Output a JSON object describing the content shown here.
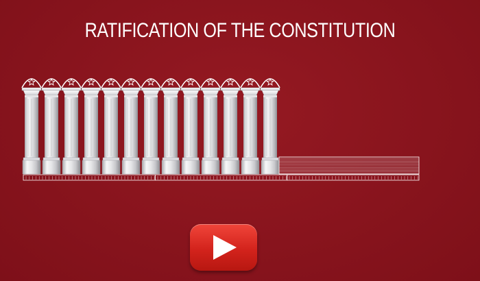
{
  "title": "RATIFICATION OF THE CONSTITUTION",
  "colonnade": {
    "total_slots": 13,
    "columns_erected": 13,
    "column_ornament": "star",
    "progress_fraction": 0.655
  },
  "colors": {
    "background": "#8b1620",
    "column": "#f2f2f2",
    "play_button": "#e0332a"
  },
  "icons": {
    "play": "play-icon",
    "star": "star-icon"
  }
}
